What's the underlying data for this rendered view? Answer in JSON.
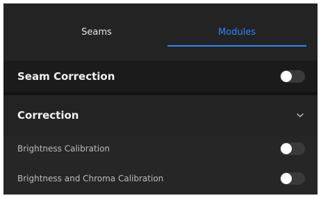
{
  "tabs": [
    {
      "label": "Seams",
      "active": false
    },
    {
      "label": "Modules",
      "active": true
    }
  ],
  "seam_correction": {
    "label": "Seam Correction",
    "enabled": false
  },
  "correction": {
    "label": "Correction",
    "expanded": true,
    "items": [
      {
        "label": "Brightness Calibration",
        "enabled": false
      },
      {
        "label": "Brightness and Chroma Calibration",
        "enabled": false
      }
    ]
  },
  "colors": {
    "accent": "#2f86ff",
    "background": "#1f1f1f",
    "toggle_off": "#3a3a3a"
  },
  "icons": {
    "expand": "chevron-down-icon"
  }
}
